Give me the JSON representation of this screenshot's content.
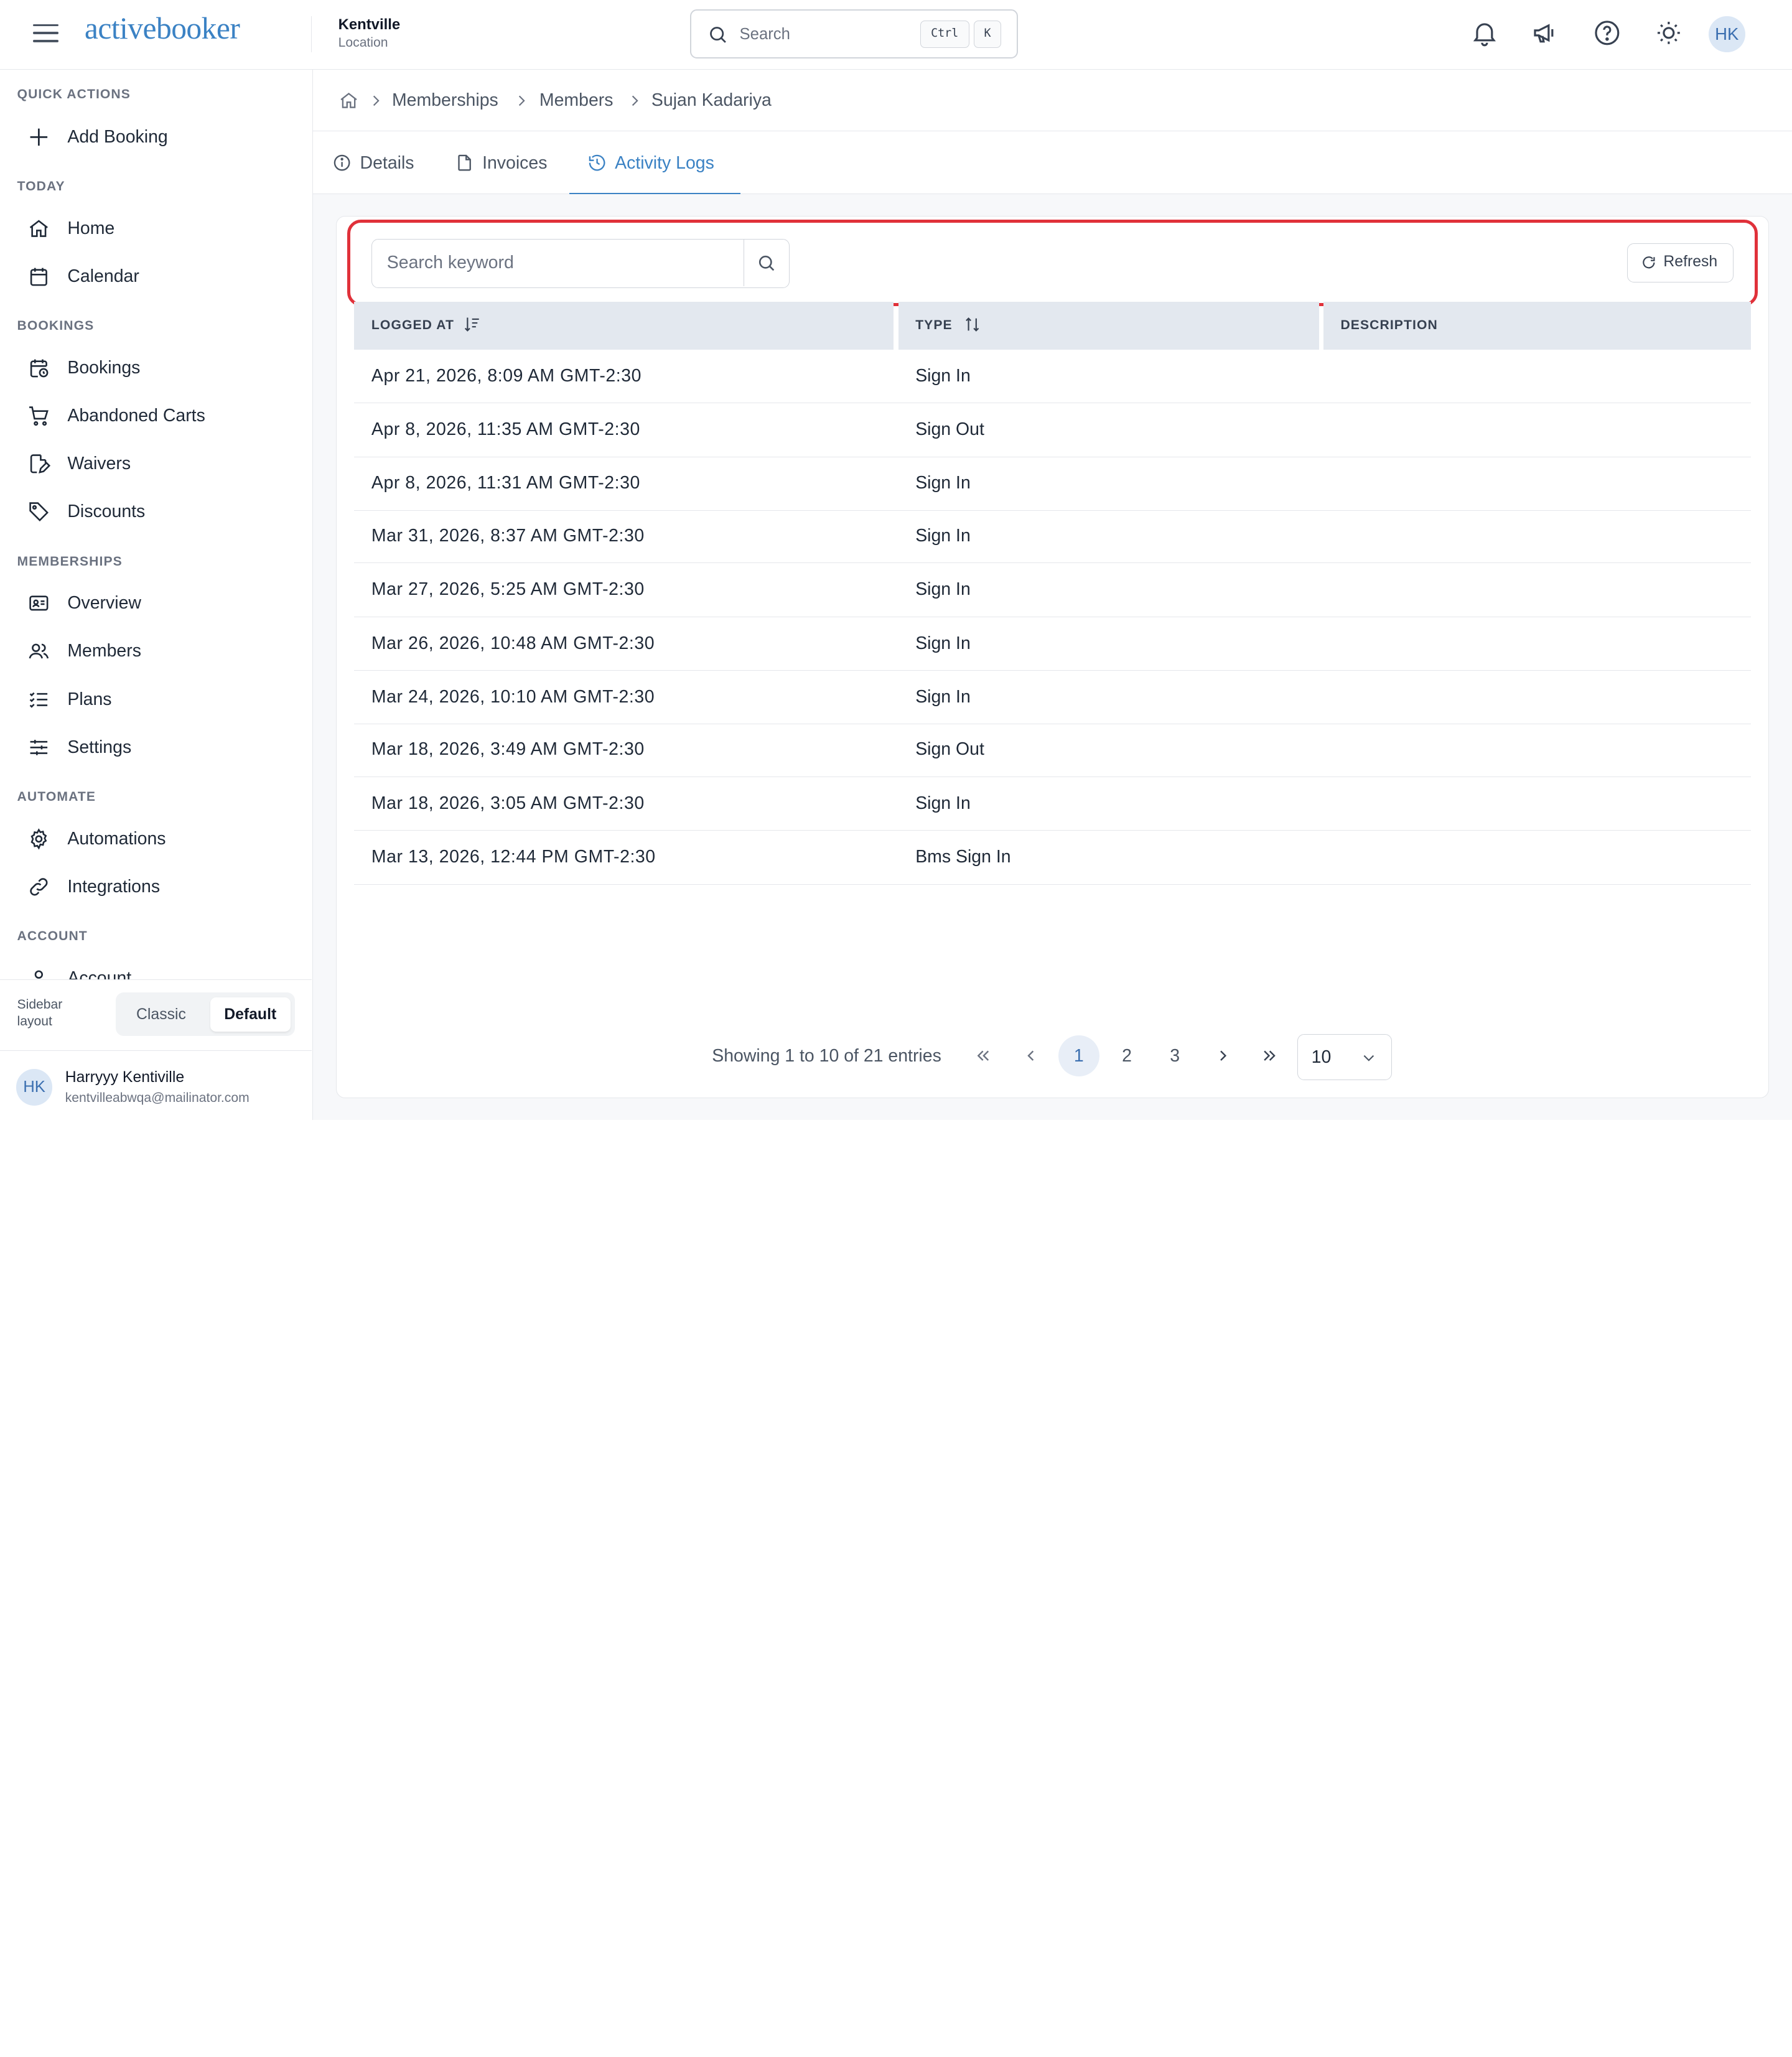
{
  "header": {
    "brand": "activebooker",
    "location_name": "Kentville",
    "location_sub": "Location",
    "search_placeholder": "Search",
    "shortcut_ctrl": "Ctrl",
    "shortcut_k": "K",
    "avatar_initials": "HK"
  },
  "sidebar": {
    "sections": {
      "quick_actions": "QUICK ACTIONS",
      "today": "TODAY",
      "bookings": "BOOKINGS",
      "memberships": "MEMBERSHIPS",
      "automate": "AUTOMATE",
      "account": "ACCOUNT"
    },
    "items": {
      "add_booking": "Add Booking",
      "home": "Home",
      "calendar": "Calendar",
      "bookings": "Bookings",
      "abandoned_carts": "Abandoned Carts",
      "waivers": "Waivers",
      "discounts": "Discounts",
      "overview": "Overview",
      "members": "Members",
      "plans": "Plans",
      "settings": "Settings",
      "automations": "Automations",
      "integrations": "Integrations",
      "account": "Account"
    },
    "layout_label": "Sidebar layout",
    "layout_classic": "Classic",
    "layout_default": "Default",
    "user": {
      "initials": "HK",
      "name": "Harryyy Kentiville",
      "email": "kentvilleabwqa@mailinator.com"
    }
  },
  "breadcrumb": [
    "Memberships",
    "Members",
    "Sujan Kadariya"
  ],
  "tabs": {
    "details": "Details",
    "invoices": "Invoices",
    "activity_logs": "Activity Logs"
  },
  "toolbar": {
    "search_placeholder": "Search keyword",
    "refresh_label": "Refresh"
  },
  "table": {
    "columns": [
      "LOGGED AT",
      "TYPE",
      "DESCRIPTION"
    ],
    "rows": [
      {
        "logged_at": "Apr 21, 2026, 8:09 AM GMT-2:30",
        "type": "Sign In",
        "description": ""
      },
      {
        "logged_at": "Apr 8, 2026, 11:35 AM GMT-2:30",
        "type": "Sign Out",
        "description": ""
      },
      {
        "logged_at": "Apr 8, 2026, 11:31 AM GMT-2:30",
        "type": "Sign In",
        "description": ""
      },
      {
        "logged_at": "Mar 31, 2026, 8:37 AM GMT-2:30",
        "type": "Sign In",
        "description": ""
      },
      {
        "logged_at": "Mar 27, 2026, 5:25 AM GMT-2:30",
        "type": "Sign In",
        "description": ""
      },
      {
        "logged_at": "Mar 26, 2026, 10:48 AM GMT-2:30",
        "type": "Sign In",
        "description": ""
      },
      {
        "logged_at": "Mar 24, 2026, 10:10 AM GMT-2:30",
        "type": "Sign In",
        "description": ""
      },
      {
        "logged_at": "Mar 18, 2026, 3:49 AM GMT-2:30",
        "type": "Sign Out",
        "description": ""
      },
      {
        "logged_at": "Mar 18, 2026, 3:05 AM GMT-2:30",
        "type": "Sign In",
        "description": ""
      },
      {
        "logged_at": "Mar 13, 2026, 12:44 PM GMT-2:30",
        "type": "Bms Sign In",
        "description": ""
      }
    ]
  },
  "pagination": {
    "info": "Showing 1 to 10 of 21 entries",
    "pages": [
      "1",
      "2",
      "3"
    ],
    "current_page": "1",
    "page_size": "10"
  },
  "colors": {
    "accent": "#3b82c4",
    "highlight": "#e0313a",
    "header_bg": "#e3e8ef"
  }
}
